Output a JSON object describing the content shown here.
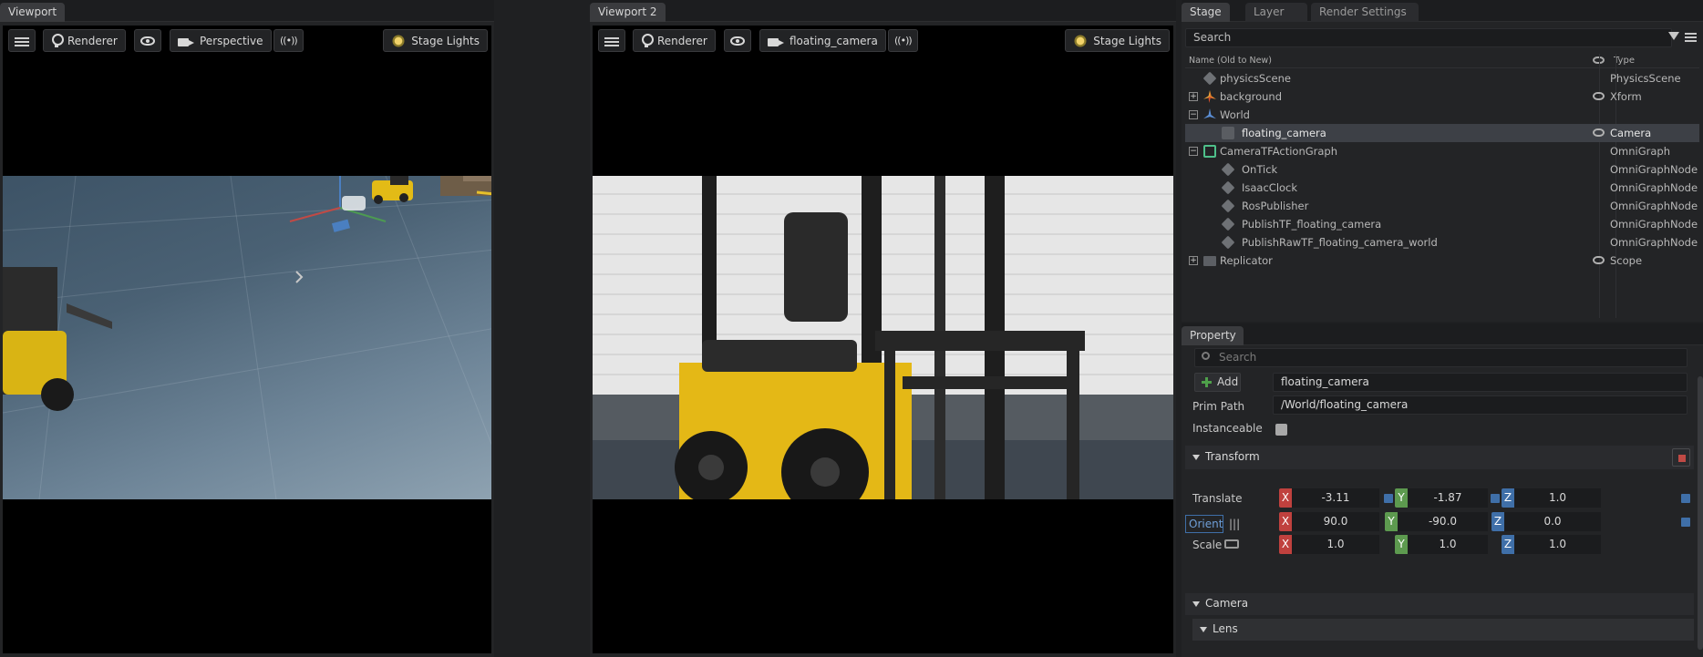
{
  "viewport1": {
    "tab": "Viewport",
    "renderer": "Renderer",
    "camera": "Perspective",
    "lights": "Stage Lights"
  },
  "viewport2": {
    "tab": "Viewport 2",
    "renderer": "Renderer",
    "camera": "floating_camera",
    "lights": "Stage Lights"
  },
  "stage": {
    "tabs": [
      "Stage",
      "Layer",
      "Render Settings"
    ],
    "search_placeholder": "Search",
    "col_name": "Name (Old to New)",
    "col_type": "Type",
    "rows": [
      {
        "name": "physicsScene",
        "type": "PhysicsScene",
        "icon": "prim-cube-icon"
      },
      {
        "name": "background",
        "type": "Xform",
        "icon": "xform-icon"
      },
      {
        "name": "World",
        "type": "",
        "icon": "xform-icon"
      },
      {
        "name": "floating_camera",
        "type": "Camera",
        "icon": "camera-icon"
      },
      {
        "name": "CameraTFActionGraph",
        "type": "OmniGraph",
        "icon": "omnigraph-icon"
      },
      {
        "name": "OnTick",
        "type": "OmniGraphNode",
        "icon": "prim-cube-icon"
      },
      {
        "name": "IsaacClock",
        "type": "OmniGraphNode",
        "icon": "prim-cube-icon"
      },
      {
        "name": "RosPublisher",
        "type": "OmniGraphNode",
        "icon": "prim-cube-icon"
      },
      {
        "name": "PublishTF_floating_camera",
        "type": "OmniGraphNode",
        "icon": "prim-cube-icon"
      },
      {
        "name": "PublishRawTF_floating_camera_world",
        "type": "OmniGraphNode",
        "icon": "prim-cube-icon"
      },
      {
        "name": "Replicator",
        "type": "Scope",
        "icon": "folder-icon"
      }
    ]
  },
  "property": {
    "tab": "Property",
    "search_placeholder": "Search",
    "add_label": "Add",
    "prim_name": "floating_camera",
    "prim_path_label": "Prim Path",
    "prim_path": "/World/floating_camera",
    "instanceable_label": "Instanceable",
    "transform_header": "Transform",
    "translate_label": "Translate",
    "orient_label": "Orient",
    "scale_label": "Scale",
    "translate": {
      "x": "-3.11",
      "y": "-1.87",
      "z": "1.0"
    },
    "orient": {
      "x": "90.0",
      "y": "-90.0",
      "z": "0.0"
    },
    "scale": {
      "x": "1.0",
      "y": "1.0",
      "z": "1.0"
    },
    "axes": {
      "x": "X",
      "y": "Y",
      "z": "Z"
    },
    "camera_header": "Camera",
    "lens_header": "Lens"
  },
  "colors": {
    "axis_x": "#c0413e",
    "axis_y": "#5d9a4f",
    "axis_z": "#3f6fa8",
    "selected_row": "#3d4046"
  }
}
